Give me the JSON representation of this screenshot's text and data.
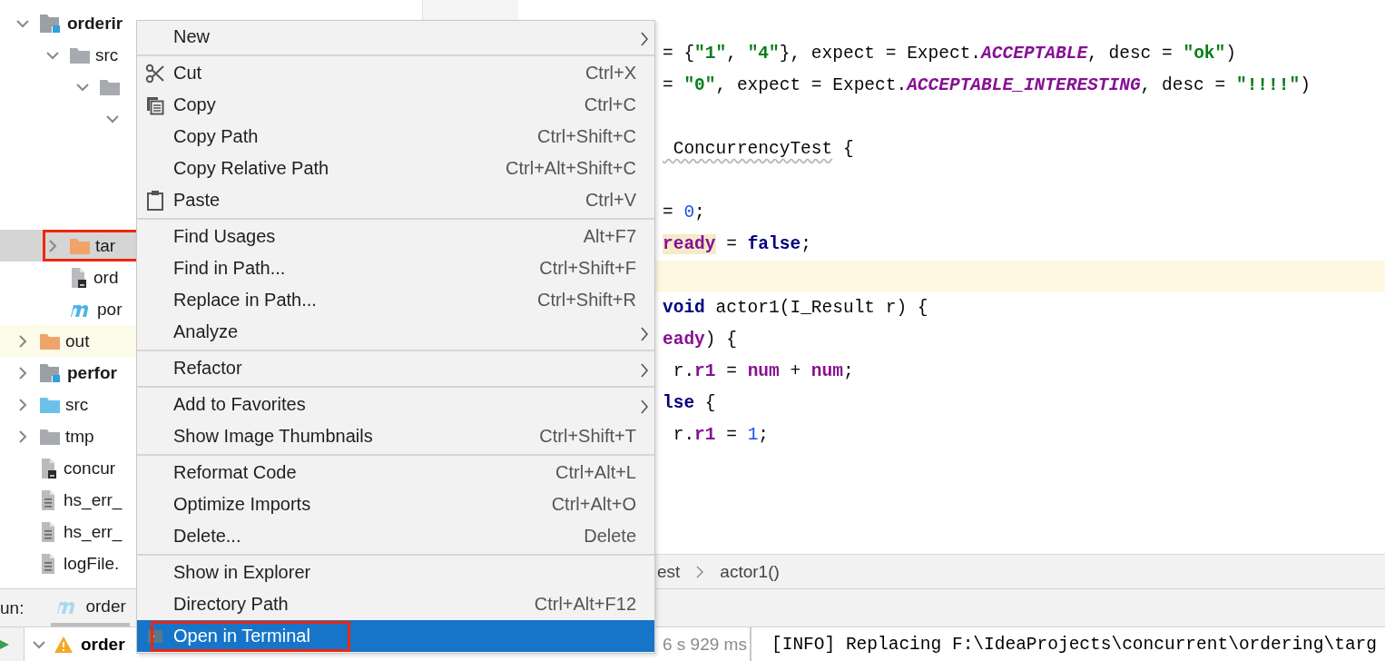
{
  "project_tree": [
    {
      "label": "orderir",
      "kind": "module",
      "expanded": true,
      "selected": false,
      "highlighted": false,
      "children": [
        {
          "label": "src",
          "kind": "folder",
          "expanded": true,
          "selected": false,
          "highlighted": false,
          "children": [
            {
              "kind": "folder",
              "expanded": true,
              "selected": false,
              "highlighted": false,
              "children": [
                {
                  "expanded": true,
                  "selected": false,
                  "highlighted": false
                }
              ]
            }
          ]
        },
        {
          "label": "tar",
          "kind": "excluded-folder",
          "expanded": false,
          "selected": true,
          "highlighted": true
        },
        {
          "label": "ord",
          "kind": "script-file",
          "selected": false,
          "highlighted": false
        },
        {
          "label": "por",
          "kind": "maven-file",
          "selected": false,
          "highlighted": false
        }
      ]
    },
    {
      "label": "out",
      "kind": "excluded-folder",
      "expanded": false,
      "selected": false,
      "highlighted": false
    },
    {
      "label": "perfor",
      "kind": "module",
      "expanded": false,
      "selected": false,
      "highlighted": false
    },
    {
      "label": "src",
      "kind": "source-folder",
      "expanded": false,
      "selected": false,
      "highlighted": false
    },
    {
      "label": "tmp",
      "kind": "folder",
      "expanded": false,
      "selected": false,
      "highlighted": false
    },
    {
      "label": "concur",
      "kind": "script-file",
      "selected": false,
      "highlighted": false
    },
    {
      "label": "hs_err_",
      "kind": "text-file",
      "selected": false,
      "highlighted": false
    },
    {
      "label": "hs_err_",
      "kind": "text-file",
      "selected": false,
      "highlighted": false
    },
    {
      "label": "logFile.",
      "kind": "text-file",
      "selected": false,
      "highlighted": false
    }
  ],
  "context_menu": {
    "groups": [
      [
        {
          "label": "New",
          "kind": "plain",
          "submenu": true,
          "selected": false,
          "highlighted": false
        }
      ],
      [
        {
          "label": "Cut",
          "kind": "cut",
          "shortcut": "Ctrl+X",
          "submenu": false,
          "selected": false,
          "highlighted": false
        },
        {
          "label": "Copy",
          "kind": "copy",
          "shortcut": "Ctrl+C",
          "submenu": false,
          "selected": false,
          "highlighted": false
        },
        {
          "label": "Copy Path",
          "kind": "plain",
          "shortcut": "Ctrl+Shift+C",
          "submenu": false,
          "selected": false,
          "highlighted": false
        },
        {
          "label": "Copy Relative Path",
          "kind": "plain",
          "shortcut": "Ctrl+Alt+Shift+C",
          "submenu": false,
          "selected": false,
          "highlighted": false
        },
        {
          "label": "Paste",
          "kind": "paste",
          "shortcut": "Ctrl+V",
          "submenu": false,
          "selected": false,
          "highlighted": false
        }
      ],
      [
        {
          "label": "Find Usages",
          "kind": "plain",
          "shortcut": "Alt+F7",
          "submenu": false,
          "selected": false,
          "highlighted": false
        },
        {
          "label": "Find in Path...",
          "kind": "plain",
          "shortcut": "Ctrl+Shift+F",
          "submenu": false,
          "selected": false,
          "highlighted": false
        },
        {
          "label": "Replace in Path...",
          "kind": "plain",
          "shortcut": "Ctrl+Shift+R",
          "submenu": false,
          "selected": false,
          "highlighted": false
        },
        {
          "label": "Analyze",
          "kind": "plain",
          "submenu": true,
          "selected": false,
          "highlighted": false
        }
      ],
      [
        {
          "label": "Refactor",
          "kind": "plain",
          "submenu": true,
          "selected": false,
          "highlighted": false
        }
      ],
      [
        {
          "label": "Add to Favorites",
          "kind": "plain",
          "submenu": true,
          "selected": false,
          "highlighted": false
        },
        {
          "label": "Show Image Thumbnails",
          "kind": "plain",
          "shortcut": "Ctrl+Shift+T",
          "submenu": false,
          "selected": false,
          "highlighted": false
        }
      ],
      [
        {
          "label": "Reformat Code",
          "kind": "plain",
          "shortcut": "Ctrl+Alt+L",
          "submenu": false,
          "selected": false,
          "highlighted": false
        },
        {
          "label": "Optimize Imports",
          "kind": "plain",
          "shortcut": "Ctrl+Alt+O",
          "submenu": false,
          "selected": false,
          "highlighted": false
        },
        {
          "label": "Delete...",
          "kind": "plain",
          "shortcut": "Delete",
          "submenu": false,
          "selected": false,
          "highlighted": false
        }
      ],
      [
        {
          "label": "Show in Explorer",
          "kind": "plain",
          "submenu": false,
          "selected": false,
          "highlighted": false
        },
        {
          "label": "Directory Path",
          "kind": "plain",
          "shortcut": "Ctrl+Alt+F12",
          "submenu": false,
          "selected": false,
          "highlighted": false
        },
        {
          "label": "Open in Terminal",
          "kind": "terminal",
          "submenu": false,
          "selected": true,
          "highlighted": true
        }
      ]
    ]
  },
  "editor": {
    "lines": [
      {
        "current": false,
        "tokens": [
          {
            "text": "= {",
            "kind": "plain"
          },
          {
            "text": "\"1\"",
            "kind": "string"
          },
          {
            "text": ", ",
            "kind": "plain"
          },
          {
            "text": "\"4\"",
            "kind": "string"
          },
          {
            "text": "}, expect = Expect.",
            "kind": "plain"
          },
          {
            "text": "ACCEPTABLE",
            "kind": "constant"
          },
          {
            "text": ", desc = ",
            "kind": "plain"
          },
          {
            "text": "\"ok\"",
            "kind": "string"
          },
          {
            "text": ")",
            "kind": "plain"
          }
        ]
      },
      {
        "current": false,
        "tokens": [
          {
            "text": "= ",
            "kind": "plain"
          },
          {
            "text": "\"0\"",
            "kind": "string"
          },
          {
            "text": ", expect = Expect.",
            "kind": "plain"
          },
          {
            "text": "ACCEPTABLE_INTERESTING",
            "kind": "constant"
          },
          {
            "text": ", desc = ",
            "kind": "plain"
          },
          {
            "text": "\"!!!!\"",
            "kind": "string"
          },
          {
            "text": ")",
            "kind": "plain"
          }
        ]
      },
      {
        "current": false
      },
      {
        "current": false,
        "tokens": [
          {
            "text": " ConcurrencyTest",
            "kind": "warning"
          },
          {
            "text": " {",
            "kind": "plain"
          }
        ]
      },
      {
        "current": false
      },
      {
        "current": false,
        "tokens": [
          {
            "text": "= ",
            "kind": "plain"
          },
          {
            "text": "0",
            "kind": "number"
          },
          {
            "text": ";",
            "kind": "plain"
          }
        ]
      },
      {
        "current": false,
        "tokens": [
          {
            "text": "ready",
            "kind": "marked-field"
          },
          {
            "text": " = ",
            "kind": "plain"
          },
          {
            "text": "false",
            "kind": "keyword"
          },
          {
            "text": ";",
            "kind": "plain"
          }
        ]
      },
      {
        "current": true
      },
      {
        "current": false,
        "tokens": [
          {
            "text": "void",
            "kind": "keyword"
          },
          {
            "text": " actor1(I_Result r) {",
            "kind": "plain"
          }
        ]
      },
      {
        "current": false,
        "tokens": [
          {
            "text": "eady",
            "kind": "field"
          },
          {
            "text": ") {",
            "kind": "plain"
          }
        ]
      },
      {
        "current": false,
        "tokens": [
          {
            "text": " r.",
            "kind": "plain"
          },
          {
            "text": "r1",
            "kind": "field"
          },
          {
            "text": " = ",
            "kind": "plain"
          },
          {
            "text": "num",
            "kind": "field"
          },
          {
            "text": " + ",
            "kind": "plain"
          },
          {
            "text": "num",
            "kind": "field"
          },
          {
            "text": ";",
            "kind": "plain"
          }
        ]
      },
      {
        "current": false,
        "tokens": [
          {
            "text": "lse",
            "kind": "keyword"
          },
          {
            "text": " {",
            "kind": "plain"
          }
        ]
      },
      {
        "current": false,
        "tokens": [
          {
            "text": " r.",
            "kind": "plain"
          },
          {
            "text": "r1",
            "kind": "field"
          },
          {
            "text": " = ",
            "kind": "plain"
          },
          {
            "text": "1",
            "kind": "number"
          },
          {
            "text": ";",
            "kind": "plain"
          }
        ]
      }
    ],
    "breadcrumb": [
      "est",
      "actor1()"
    ]
  },
  "run_panel": {
    "label": "un:",
    "tab": "order",
    "tree": [
      {
        "label": "order",
        "kind": "warning",
        "expanded": true
      }
    ],
    "duration": "6 s 929 ms",
    "console": [
      "[INFO] Replacing F:\\IdeaProjects\\concurrent\\ordering\\targ"
    ]
  }
}
